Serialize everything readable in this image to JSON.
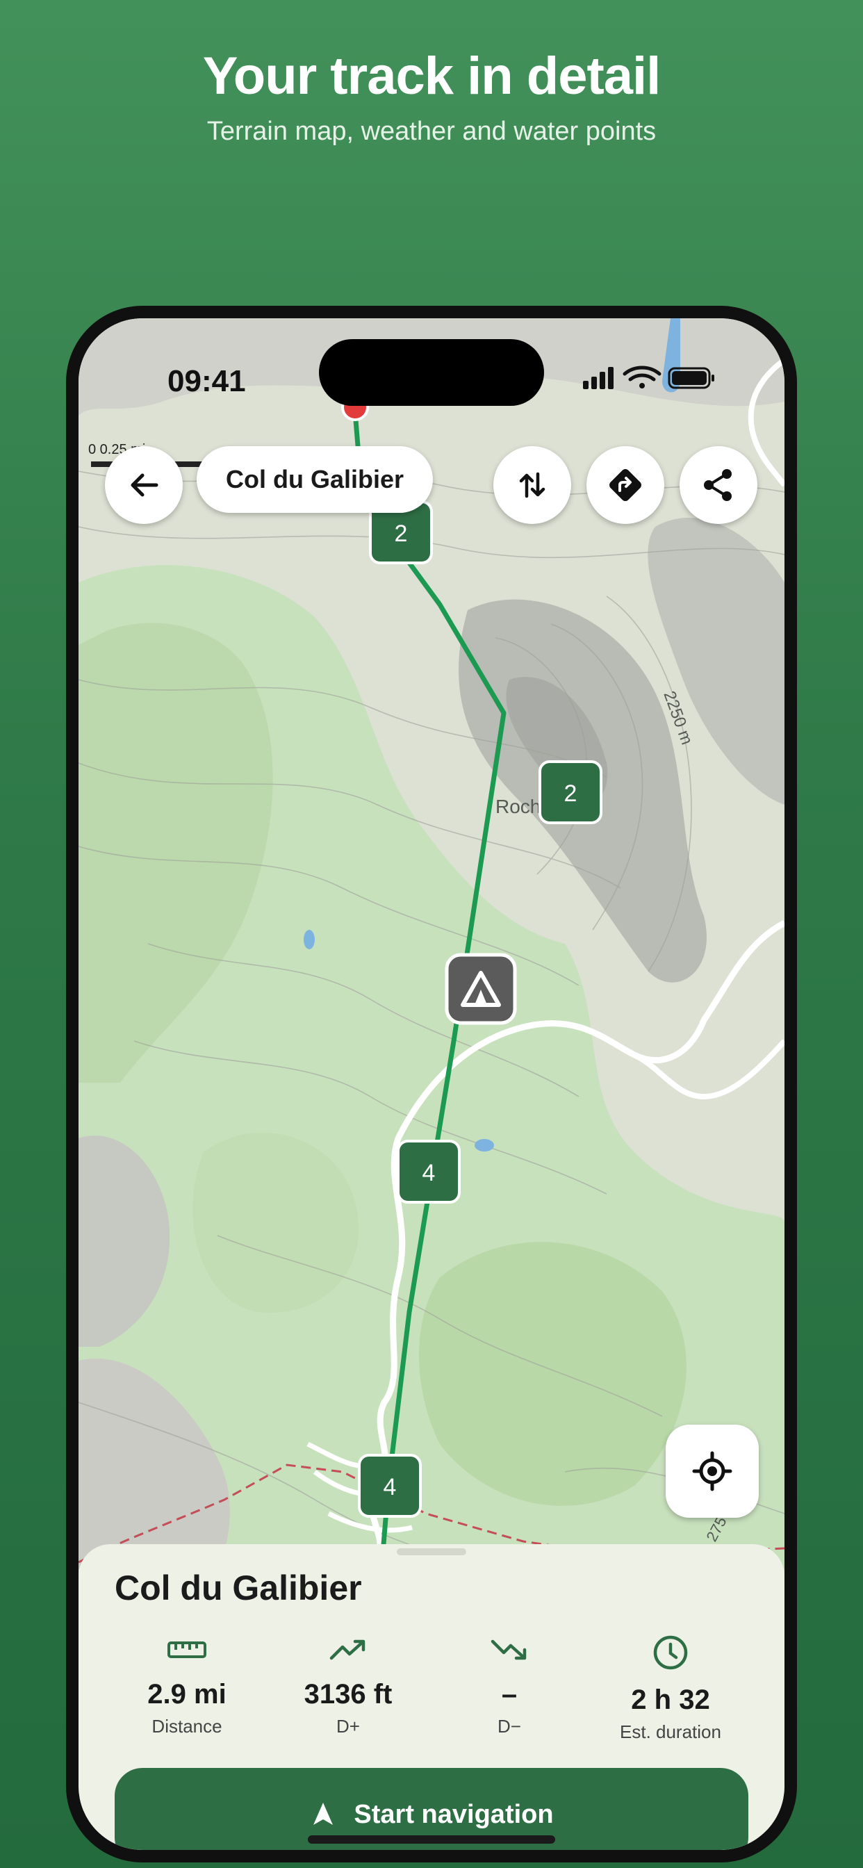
{
  "hero": {
    "title": "Your track in detail",
    "subtitle": "Terrain map, weather and water points"
  },
  "status_bar": {
    "time": "09:41"
  },
  "map": {
    "scale_label": "0      0.25 mi",
    "place_label": "Roch    ra",
    "contour_labels": [
      "2250 m",
      "275"
    ],
    "track_color": "#1d9a52",
    "waypoint_markers": [
      {
        "label": "2"
      },
      {
        "label": "2"
      },
      {
        "label": "4"
      },
      {
        "label": "4"
      }
    ],
    "poi_icon": "campsite-icon"
  },
  "toolbar": {
    "back_icon": "arrow-left-icon",
    "title": "Col du Galibier",
    "reverse_icon": "swap-vertical-icon",
    "directions_icon": "directions-icon",
    "share_icon": "share-icon",
    "locate_icon": "locate-icon"
  },
  "sheet": {
    "title": "Col du Galibier",
    "stats": [
      {
        "icon": "ruler-icon",
        "value": "2.9 mi",
        "label": "Distance"
      },
      {
        "icon": "ascent-icon",
        "value": "3136 ft",
        "label": "D+"
      },
      {
        "icon": "descent-icon",
        "value": "–",
        "label": "D−"
      },
      {
        "icon": "clock-icon",
        "value": "2 h 32",
        "label": "Est. duration"
      }
    ],
    "start_button": "Start navigation"
  },
  "colors": {
    "background": "#3a8651",
    "accent": "#2e6e45",
    "track": "#1d9a52",
    "sheet": "#eef1e6"
  }
}
